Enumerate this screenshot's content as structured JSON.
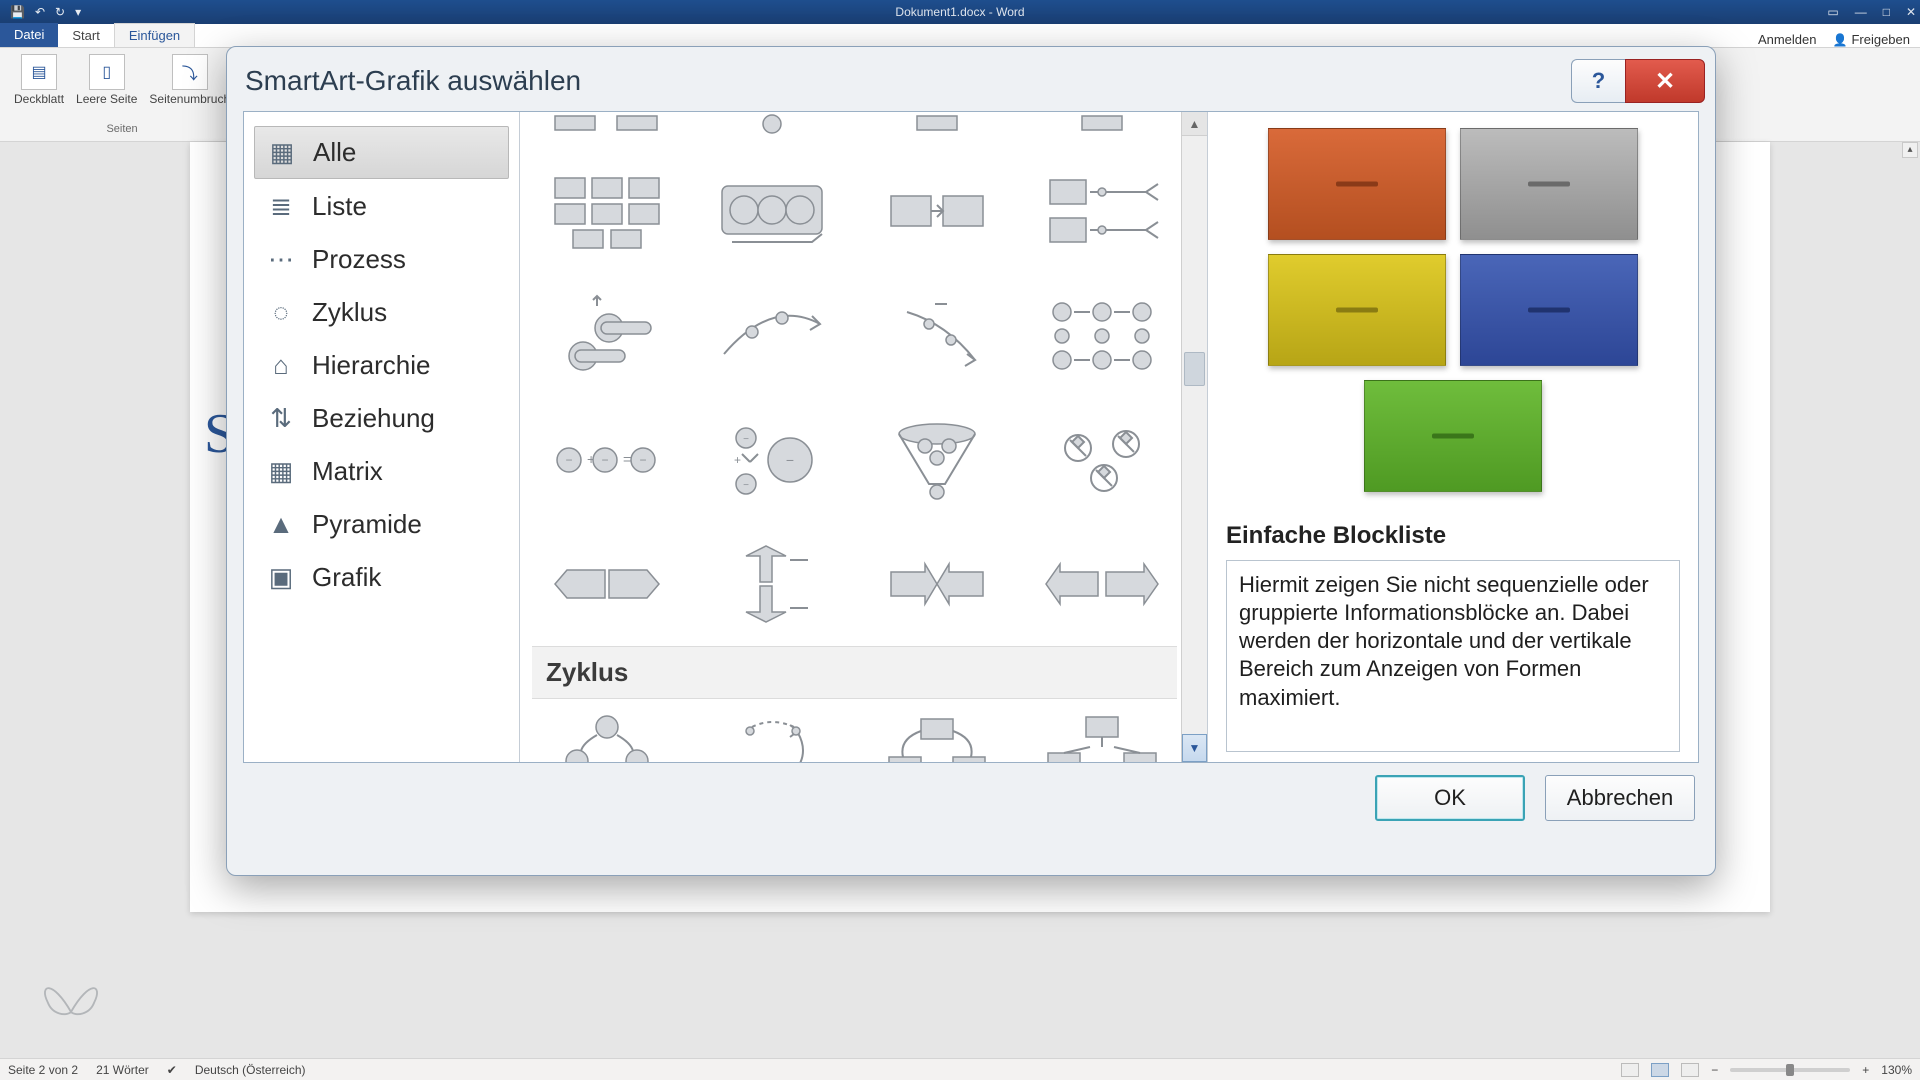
{
  "titlebar": {
    "doc_title": "Dokument1.docx - Word",
    "qat": {
      "save": "💾",
      "undo": "↶",
      "redo": "↻",
      "more": "▾"
    },
    "win": {
      "opts": "▭",
      "min": "—",
      "max": "□",
      "close": "✕"
    }
  },
  "ribbon_tabs": {
    "file": "Datei",
    "tabs": [
      "Start",
      "Einfügen"
    ],
    "active_index": 1,
    "signin": "Anmelden",
    "share": "Freigeben",
    "share_icon": "👤"
  },
  "ribbon": {
    "buttons": [
      {
        "label": "Deckblatt",
        "glyph": "▤"
      },
      {
        "label": "Leere Seite",
        "glyph": "▯"
      },
      {
        "label": "Seitenumbruch",
        "glyph": "⤵"
      }
    ],
    "group_label": "Seiten"
  },
  "dialog": {
    "title": "SmartArt-Grafik auswählen",
    "categories": [
      {
        "label": "Alle",
        "icon": "▦"
      },
      {
        "label": "Liste",
        "icon": "≣"
      },
      {
        "label": "Prozess",
        "icon": "⋯"
      },
      {
        "label": "Zyklus",
        "icon": "◌"
      },
      {
        "label": "Hierarchie",
        "icon": "⌂"
      },
      {
        "label": "Beziehung",
        "icon": "⇅"
      },
      {
        "label": "Matrix",
        "icon": "▦"
      },
      {
        "label": "Pyramide",
        "icon": "▲"
      },
      {
        "label": "Grafik",
        "icon": "▣"
      }
    ],
    "selected_category_index": 0,
    "section_header": "Zyklus",
    "preview": {
      "title": "Einfache Blockliste",
      "description": "Hiermit zeigen Sie nicht sequenzielle oder gruppierte Informationsblöcke an. Dabei werden der horizontale und der vertikale Bereich zum Anzeigen von Formen maximiert.",
      "colors": [
        "#c65a2c",
        "#9a9a9a",
        "#c7b61f",
        "#3a55a4",
        "#57a82d"
      ]
    },
    "ok": "OK",
    "cancel": "Abbrechen",
    "scroll": {
      "up": "▲",
      "down": "▼"
    }
  },
  "statusbar": {
    "page": "Seite 2 von 2",
    "words": "21 Wörter",
    "lang": "Deutsch (Österreich)",
    "zoom_minus": "−",
    "zoom_plus": "+",
    "zoom": "130%"
  },
  "doc_hint_letter": "S"
}
